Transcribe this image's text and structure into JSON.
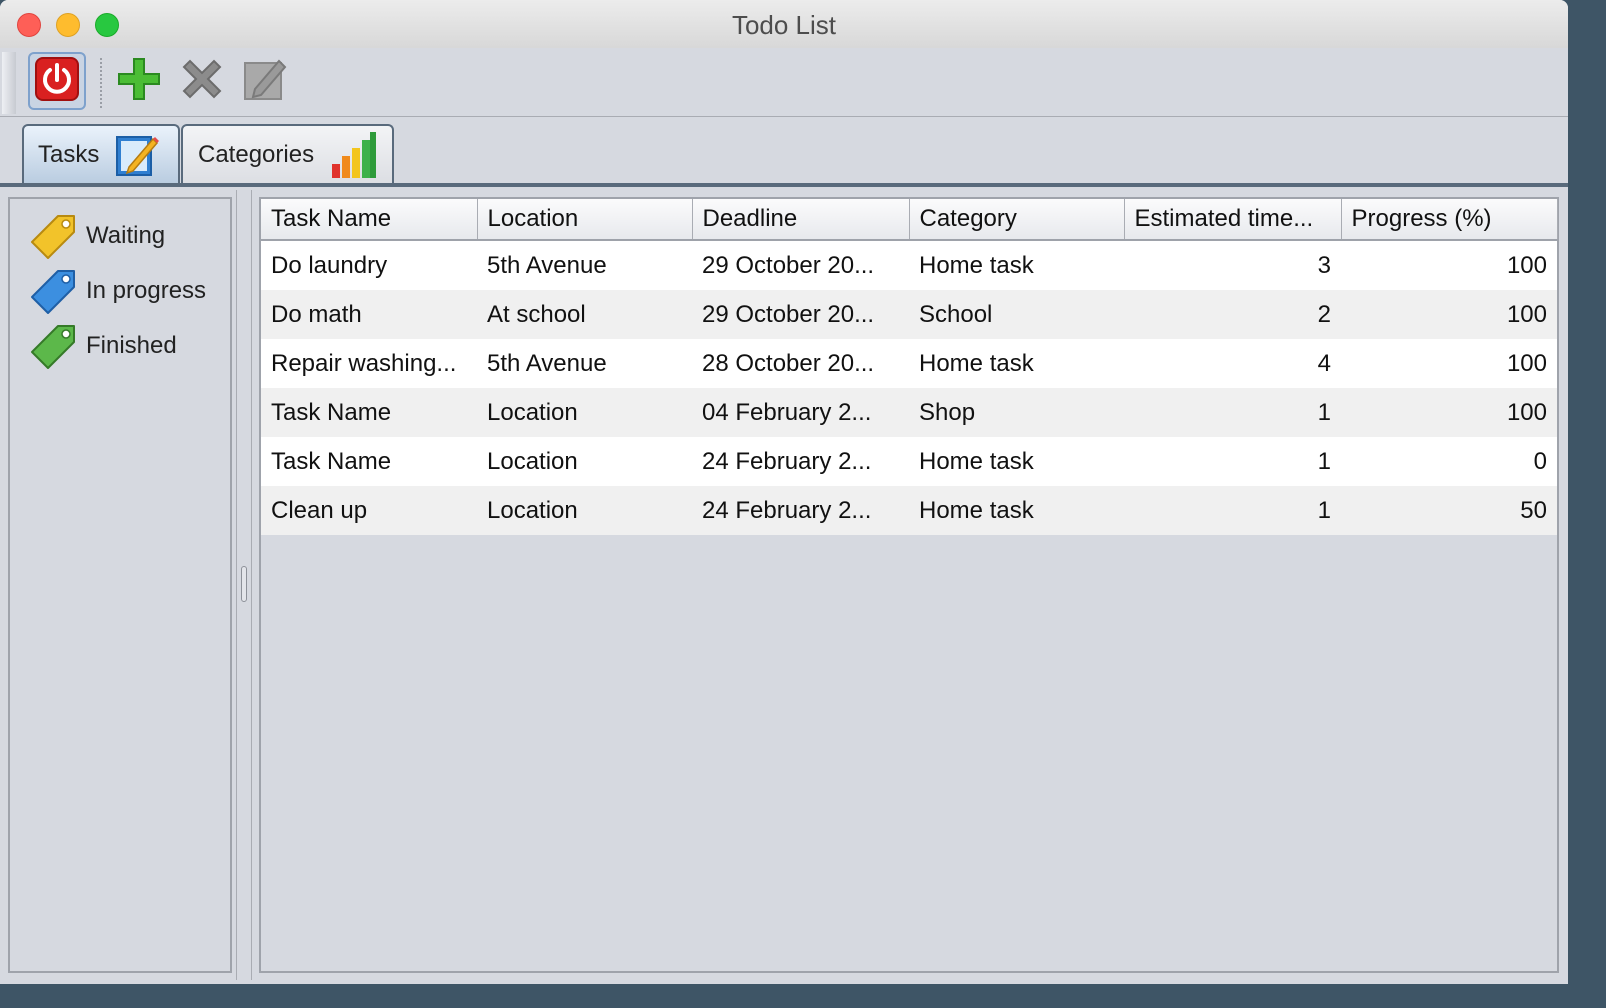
{
  "window": {
    "title": "Todo List"
  },
  "toolbar": {
    "buttons": [
      {
        "icon": "power-icon",
        "color": "#d92020"
      },
      {
        "icon": "add-icon",
        "color": "#3aa12a"
      },
      {
        "icon": "delete-icon",
        "color": "#8c8c8c"
      },
      {
        "icon": "edit-icon",
        "color": "#9a9a9a"
      }
    ]
  },
  "tabs": [
    {
      "label": "Tasks",
      "icon": "notepad-pencil-icon",
      "selected": true
    },
    {
      "label": "Categories",
      "icon": "bar-chart-icon",
      "selected": false
    }
  ],
  "statuses": [
    {
      "label": "Waiting",
      "icon": "tag-yellow-icon",
      "color": "#f2c32a"
    },
    {
      "label": "In progress",
      "icon": "tag-blue-icon",
      "color": "#3c8fe0"
    },
    {
      "label": "Finished",
      "icon": "tag-green-icon",
      "color": "#5cb84a"
    }
  ],
  "table": {
    "columns": [
      "Task Name",
      "Location",
      "Deadline",
      "Category",
      "Estimated time...",
      "Progress (%)"
    ],
    "rows": [
      [
        "Do laundry",
        "5th Avenue",
        "29 October 20...",
        "Home task",
        "3",
        "100"
      ],
      [
        "Do math",
        "At school",
        "29 October 20...",
        "School",
        "2",
        "100"
      ],
      [
        "Repair washing...",
        "5th Avenue",
        "28 October 20...",
        "Home task",
        "4",
        "100"
      ],
      [
        "Task Name",
        "Location",
        "04 February 2...",
        "Shop",
        "1",
        "100"
      ],
      [
        "Task Name",
        "Location",
        "24 February 2...",
        "Home task",
        "1",
        "0"
      ],
      [
        "Clean up",
        "Location",
        "24 February 2...",
        "Home task",
        "1",
        "50"
      ]
    ]
  }
}
